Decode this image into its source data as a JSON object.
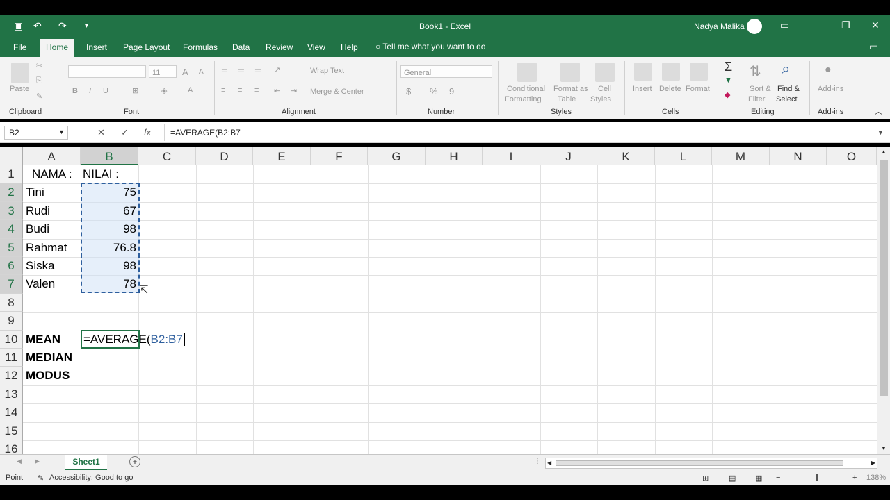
{
  "window": {
    "title": "Book1  -  Excel",
    "user": "Nadya Malika",
    "minimize": "—",
    "restore": "❐",
    "close": "✕",
    "ribbon_display": "▭"
  },
  "quick_access": {
    "save": "▣",
    "undo": "↶",
    "redo": "↷",
    "customize": "▾"
  },
  "menu": {
    "tabs": [
      "File",
      "Home",
      "Insert",
      "Page Layout",
      "Formulas",
      "Data",
      "Review",
      "View",
      "Help"
    ],
    "active": "Home",
    "tell_me": "Tell me what you want to do"
  },
  "ribbon": {
    "clipboard": {
      "label": "Clipboard",
      "paste": "Paste"
    },
    "font": {
      "label": "Font",
      "size": "11",
      "bold": "B",
      "italic": "I",
      "underline": "U",
      "grow": "A",
      "shrink": "A"
    },
    "alignment": {
      "label": "Alignment",
      "wrap_text": "Wrap Text",
      "merge_center": "Merge & Center"
    },
    "number": {
      "label": "Number",
      "format": "General",
      "currency": "$",
      "percent": "%",
      "comma": "9"
    },
    "styles": {
      "label": "Styles",
      "conditional_formatting": "Conditional",
      "conditional_formatting2": "Formatting",
      "format_as_table": "Format as",
      "format_as_table2": "Table",
      "cell_styles": "Cell",
      "cell_styles2": "Styles"
    },
    "cells": {
      "label": "Cells",
      "insert": "Insert",
      "delete": "Delete",
      "format": "Format"
    },
    "editing": {
      "label": "Editing",
      "sort_filter": "Sort &",
      "sort_filter2": "Filter",
      "find_select": "Find &",
      "find_select2": "Select"
    },
    "addins": {
      "label": "Add-ins",
      "addins": "Add-ins"
    }
  },
  "formula_bar": {
    "name_box": "B2",
    "cancel": "✕",
    "enter": "✓",
    "fx": "fx",
    "formula": "=AVERAGE(B2:B7"
  },
  "grid": {
    "columns": [
      "A",
      "B",
      "C",
      "D",
      "E",
      "F",
      "G",
      "H",
      "I",
      "J",
      "K",
      "L",
      "M",
      "N",
      "O"
    ],
    "rows": [
      "1",
      "2",
      "3",
      "4",
      "5",
      "6",
      "7",
      "8",
      "9",
      "10",
      "11",
      "12",
      "13",
      "14",
      "15",
      "16"
    ],
    "cells": {
      "A1": "NAMA :",
      "B1": "NILAI :",
      "A2": "Tini",
      "B2": "75",
      "A3": "Rudi",
      "B3": "67",
      "A4": "Budi",
      "B4": "98",
      "A5": "Rahmat",
      "B5": "76.8",
      "A6": "Siska",
      "B6": "98",
      "A7": "Valen",
      "B7": "78",
      "A10": "MEAN",
      "A11": "MEDIAN",
      "A12": "MODUS",
      "B10_func": "=AVERAGE(",
      "B10_ref": "B2:B7"
    },
    "colors": {
      "accent": "#217346",
      "range_ref": "#2e5f9e"
    }
  },
  "sheet_tabs": {
    "active": "Sheet1",
    "add": "+"
  },
  "status_bar": {
    "mode": "Point",
    "accessibility": "Accessibility: Good to go",
    "zoom": "138%"
  }
}
